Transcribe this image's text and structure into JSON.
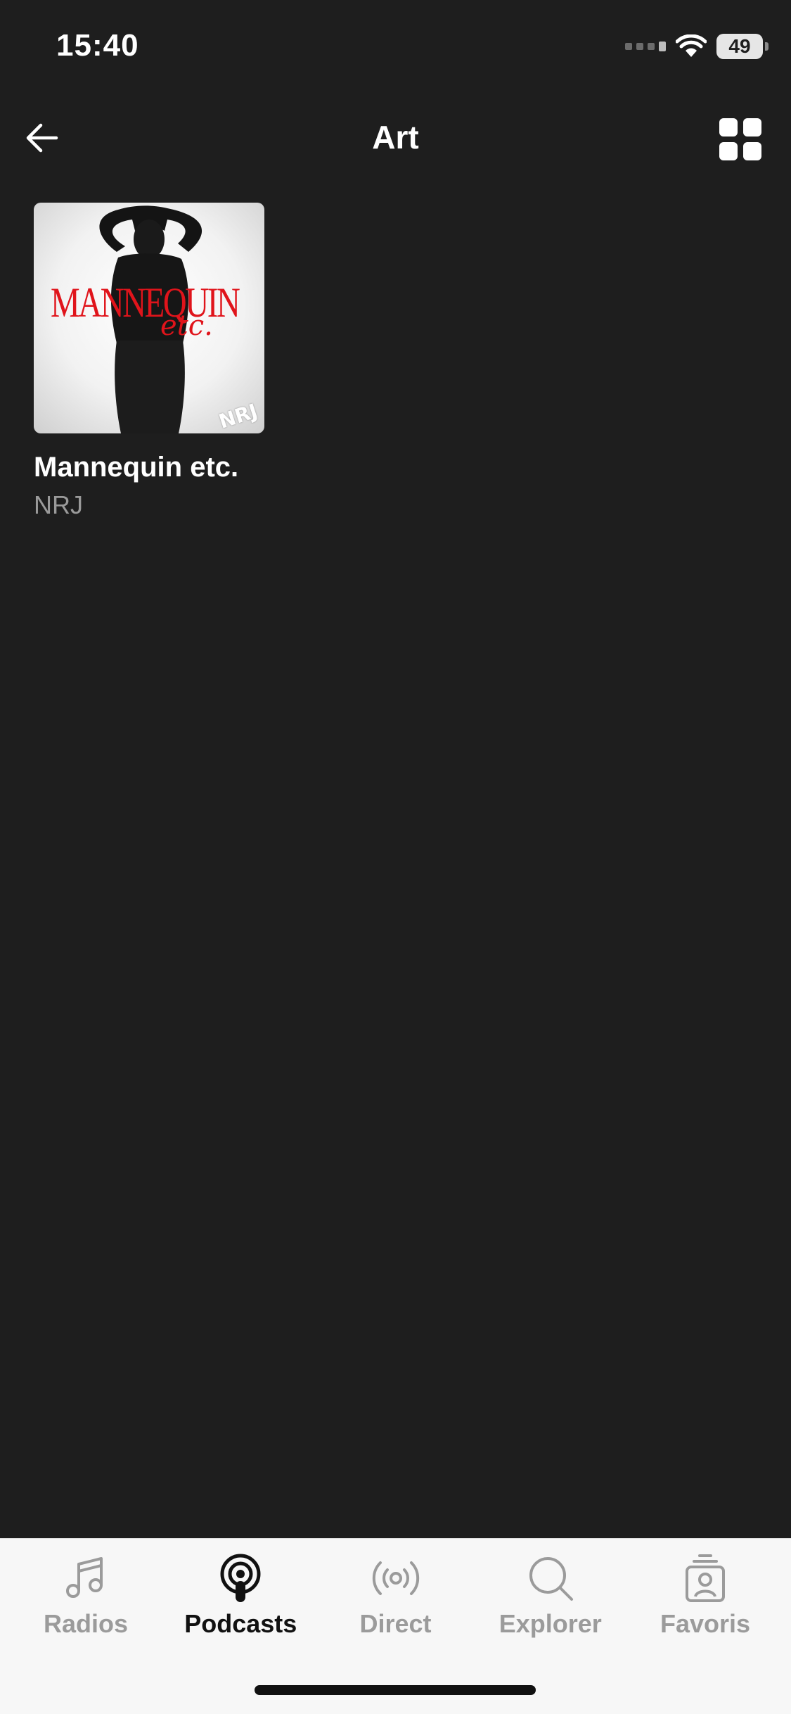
{
  "status_bar": {
    "time": "15:40",
    "battery": "49"
  },
  "header": {
    "title": "Art",
    "back_icon": "arrow-left-icon",
    "grid_icon": "grid-view-icon"
  },
  "podcasts": [
    {
      "title": "Mannequin etc.",
      "author": "NRJ",
      "cover_text": "MANNEQUIN",
      "cover_script": "etc.",
      "cover_logo": "NRJ"
    }
  ],
  "tab_bar": {
    "tabs": [
      {
        "label": "Radios",
        "icon": "music-note-icon",
        "active": false
      },
      {
        "label": "Podcasts",
        "icon": "podcast-icon",
        "active": true
      },
      {
        "label": "Direct",
        "icon": "broadcast-icon",
        "active": false
      },
      {
        "label": "Explorer",
        "icon": "search-icon",
        "active": false
      },
      {
        "label": "Favoris",
        "icon": "favorites-icon",
        "active": false
      }
    ]
  },
  "colors": {
    "background": "#1e1e1e",
    "tab_bar": "#f7f7f7",
    "accent_red": "#e0141b",
    "inactive_tab": "#9b9b9b"
  }
}
